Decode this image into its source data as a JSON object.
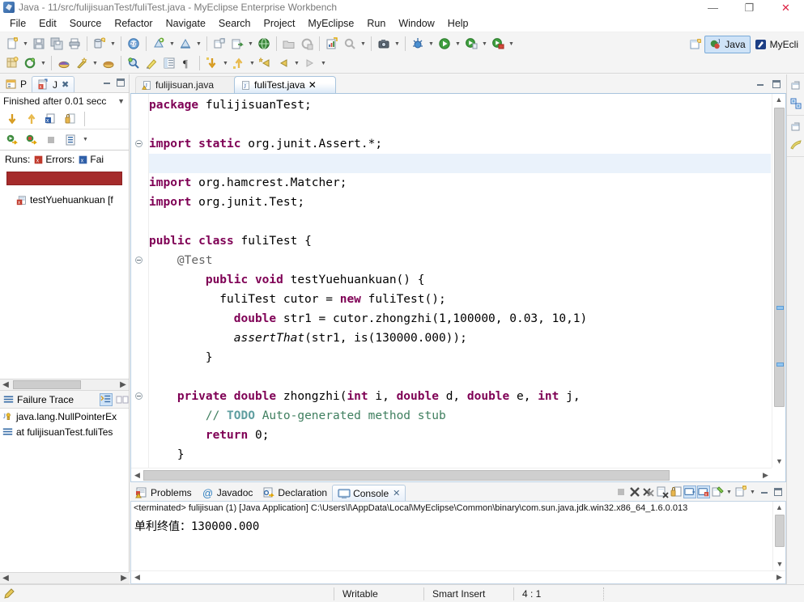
{
  "window": {
    "title": "Java - 11/src/fulijisuanTest/fuliTest.java - MyEclipse Enterprise Workbench",
    "minimize": "—",
    "maximize": "❐",
    "close": "✕"
  },
  "menubar": {
    "items": [
      {
        "label": "File"
      },
      {
        "label": "Edit"
      },
      {
        "label": "Source"
      },
      {
        "label": "Refactor"
      },
      {
        "label": "Navigate"
      },
      {
        "label": "Search"
      },
      {
        "label": "Project"
      },
      {
        "label": "MyEclipse"
      },
      {
        "label": "Run"
      },
      {
        "label": "Window"
      },
      {
        "label": "Help"
      }
    ]
  },
  "toolbar": {
    "row1": [
      {
        "name": "new-icon",
        "kind": "new"
      },
      {
        "name": "dropdown-arrow-icon",
        "kind": "arrow"
      },
      {
        "name": "save-icon",
        "kind": "save"
      },
      {
        "name": "save-all-icon",
        "kind": "saveall"
      },
      {
        "name": "print-icon",
        "kind": "print"
      },
      {
        "name": "separator",
        "kind": "sep"
      },
      {
        "name": "deploy-icon",
        "kind": "deploy"
      },
      {
        "name": "dropdown-arrow-icon",
        "kind": "arrow"
      },
      {
        "name": "separator",
        "kind": "sep"
      },
      {
        "name": "server-icon",
        "kind": "server"
      },
      {
        "name": "separator",
        "kind": "sep"
      },
      {
        "name": "db-browser-icon",
        "kind": "dbnew"
      },
      {
        "name": "dropdown-arrow-icon",
        "kind": "arrow"
      },
      {
        "name": "db-connect-icon",
        "kind": "dbconn"
      },
      {
        "name": "dropdown-arrow-icon",
        "kind": "arrow"
      },
      {
        "name": "separator",
        "kind": "sep"
      },
      {
        "name": "open-type-icon",
        "kind": "opentype"
      },
      {
        "name": "export-icon",
        "kind": "export"
      },
      {
        "name": "dropdown-arrow-icon",
        "kind": "arrow"
      },
      {
        "name": "web-browser-icon",
        "kind": "web"
      },
      {
        "name": "separator",
        "kind": "sep"
      },
      {
        "name": "open-folder-icon",
        "kind": "openfolder"
      },
      {
        "name": "refresh-icon",
        "kind": "refresh2"
      },
      {
        "name": "separator",
        "kind": "sep"
      },
      {
        "name": "report-icon",
        "kind": "report"
      },
      {
        "name": "search-icon",
        "kind": "searchgray"
      },
      {
        "name": "dropdown-arrow-icon",
        "kind": "arrow"
      },
      {
        "name": "separator",
        "kind": "sep"
      },
      {
        "name": "snapshot-icon",
        "kind": "camera"
      },
      {
        "name": "dropdown-arrow-icon",
        "kind": "arrow"
      },
      {
        "name": "separator",
        "kind": "sep"
      },
      {
        "name": "debug-icon",
        "kind": "debug"
      },
      {
        "name": "dropdown-arrow-icon",
        "kind": "arrow"
      },
      {
        "name": "run-icon",
        "kind": "run"
      },
      {
        "name": "dropdown-arrow-icon",
        "kind": "arrow"
      },
      {
        "name": "run-external-icon",
        "kind": "runext"
      },
      {
        "name": "dropdown-arrow-icon",
        "kind": "arrow"
      },
      {
        "name": "profile-icon",
        "kind": "profile"
      },
      {
        "name": "dropdown-arrow-icon",
        "kind": "arrow"
      }
    ],
    "row2": [
      {
        "name": "new-java-project-icon",
        "kind": "newjava"
      },
      {
        "name": "refresh-icon",
        "kind": "refresh"
      },
      {
        "name": "dropdown-arrow-icon",
        "kind": "arrow"
      },
      {
        "name": "separator",
        "kind": "sep"
      },
      {
        "name": "package-icon",
        "kind": "pkg"
      },
      {
        "name": "tool-icon",
        "kind": "wand"
      },
      {
        "name": "dropdown-arrow-icon",
        "kind": "arrow"
      },
      {
        "name": "package2-icon",
        "kind": "pkg2"
      },
      {
        "name": "separator",
        "kind": "sep"
      },
      {
        "name": "search-ref-icon",
        "kind": "searchref"
      },
      {
        "name": "highlight-icon",
        "kind": "highlight"
      },
      {
        "name": "outline-icon",
        "kind": "outline"
      },
      {
        "name": "pilcrow-icon",
        "kind": "pilcrow"
      },
      {
        "name": "separator",
        "kind": "sep"
      },
      {
        "name": "next-annotation-icon",
        "kind": "nextann"
      },
      {
        "name": "dropdown-arrow-icon",
        "kind": "arrow"
      },
      {
        "name": "prev-annotation-icon",
        "kind": "prevann"
      },
      {
        "name": "dropdown-arrow-icon",
        "kind": "arrow"
      },
      {
        "name": "back-star-icon",
        "kind": "backstar"
      },
      {
        "name": "back-icon",
        "kind": "back"
      },
      {
        "name": "dropdown-arrow-icon",
        "kind": "arrow"
      },
      {
        "name": "forward-icon",
        "kind": "forward"
      },
      {
        "name": "dropdown-arrow-icon",
        "kind": "arrow"
      }
    ],
    "perspectives": {
      "open_label": "",
      "items": [
        {
          "label": "Java",
          "active": true
        },
        {
          "label": "MyEcli",
          "active": false
        }
      ]
    }
  },
  "junit": {
    "tabs": [
      {
        "label": "P",
        "icon": "package-explorer-icon",
        "active": false
      },
      {
        "label": "J",
        "icon": "junit-icon",
        "active": true
      }
    ],
    "status": "Finished after 0.01 secc",
    "counts": {
      "runs_label": "Runs:",
      "runs_value": "",
      "errors_label": "Errors:",
      "errors_value": "",
      "failures_label": "Fai"
    },
    "progress_color": "#a52b2b",
    "tree": [
      {
        "label": "testYuehuankuan [f",
        "icon": "test-failed-icon"
      }
    ],
    "toolbar_row1": [
      {
        "name": "next-failure-icon"
      },
      {
        "name": "previous-failure-icon"
      },
      {
        "name": "show-failures-only-icon"
      },
      {
        "name": "lock-icon"
      }
    ],
    "toolbar_row2": [
      {
        "name": "rerun-test-icon"
      },
      {
        "name": "rerun-failed-tests-icon"
      },
      {
        "name": "stop-icon"
      },
      {
        "name": "test-history-icon"
      },
      {
        "name": "view-menu-icon"
      }
    ]
  },
  "failure_trace": {
    "title": "Failure Trace",
    "rows": [
      {
        "label": "java.lang.NullPointerEx",
        "icon": "exception-icon"
      },
      {
        "label": "at fulijisuanTest.fuliTes",
        "icon": "stackframe-icon"
      }
    ],
    "actions": [
      {
        "name": "filter-stacktrace-icon"
      },
      {
        "name": "compare-result-icon"
      }
    ]
  },
  "editor": {
    "tabs": [
      {
        "label": "fulijisuan.java",
        "active": false,
        "dirty": true,
        "icon": "java-file-warning-icon"
      },
      {
        "label": "fuliTest.java",
        "active": true,
        "dirty": false,
        "icon": "java-file-icon",
        "close": "✕"
      }
    ],
    "code_lines": [
      {
        "indent": 0,
        "fold": false,
        "highlight": false,
        "tokens": [
          {
            "t": "package",
            "c": "kw"
          },
          {
            "t": " fulijisuanTest;",
            "c": "plain"
          }
        ]
      },
      {
        "indent": 0,
        "fold": false,
        "highlight": false,
        "tokens": []
      },
      {
        "indent": 0,
        "fold": true,
        "highlight": false,
        "tokens": [
          {
            "t": "import static",
            "c": "kw"
          },
          {
            "t": " org.junit.Assert.*;",
            "c": "plain"
          }
        ]
      },
      {
        "indent": 0,
        "fold": false,
        "highlight": true,
        "tokens": []
      },
      {
        "indent": 0,
        "fold": false,
        "highlight": false,
        "tokens": [
          {
            "t": "import",
            "c": "kw"
          },
          {
            "t": " org.hamcrest.Matcher;",
            "c": "plain"
          }
        ]
      },
      {
        "indent": 0,
        "fold": false,
        "highlight": false,
        "tokens": [
          {
            "t": "import",
            "c": "kw"
          },
          {
            "t": " org.junit.Test;",
            "c": "plain"
          }
        ]
      },
      {
        "indent": 0,
        "fold": false,
        "highlight": false,
        "tokens": []
      },
      {
        "indent": 0,
        "fold": false,
        "highlight": false,
        "tokens": [
          {
            "t": "public class",
            "c": "kw"
          },
          {
            "t": " fuliTest {",
            "c": "plain"
          }
        ]
      },
      {
        "indent": 1,
        "fold": true,
        "highlight": false,
        "tokens": [
          {
            "t": "@Test",
            "c": "ann"
          }
        ]
      },
      {
        "indent": 2,
        "fold": false,
        "highlight": false,
        "tokens": [
          {
            "t": "public void",
            "c": "kw"
          },
          {
            "t": " testYuehuankuan() {",
            "c": "plain"
          }
        ]
      },
      {
        "indent": 2,
        "fold": false,
        "highlight": false,
        "tokens": [
          {
            "t": "  fuliTest cutor = ",
            "c": "plain"
          },
          {
            "t": "new",
            "c": "kw"
          },
          {
            "t": " fuliTest();",
            "c": "plain"
          }
        ]
      },
      {
        "indent": 3,
        "fold": false,
        "highlight": false,
        "tokens": [
          {
            "t": "double",
            "c": "kw"
          },
          {
            "t": " str1 = cutor.zhongzhi(1,100000, 0.03, 10,1)",
            "c": "plain"
          }
        ]
      },
      {
        "indent": 3,
        "fold": false,
        "highlight": false,
        "tokens": [
          {
            "t": "assertThat",
            "c": "ital"
          },
          {
            "t": "(str1, is(130000.000));",
            "c": "plain"
          }
        ]
      },
      {
        "indent": 2,
        "fold": false,
        "highlight": false,
        "tokens": [
          {
            "t": "}",
            "c": "plain"
          }
        ]
      },
      {
        "indent": 0,
        "fold": false,
        "highlight": false,
        "tokens": []
      },
      {
        "indent": 1,
        "fold": true,
        "highlight": false,
        "tokens": [
          {
            "t": "private double",
            "c": "kw"
          },
          {
            "t": " zhongzhi(",
            "c": "plain"
          },
          {
            "t": "int",
            "c": "kw"
          },
          {
            "t": " i, ",
            "c": "plain"
          },
          {
            "t": "double",
            "c": "kw"
          },
          {
            "t": " d, ",
            "c": "plain"
          },
          {
            "t": "double",
            "c": "kw"
          },
          {
            "t": " e, ",
            "c": "plain"
          },
          {
            "t": "int",
            "c": "kw"
          },
          {
            "t": " j, ",
            "c": "plain"
          }
        ]
      },
      {
        "indent": 2,
        "fold": false,
        "highlight": false,
        "tokens": [
          {
            "t": "// ",
            "c": "cmt"
          },
          {
            "t": "TODO",
            "c": "todo"
          },
          {
            "t": " Auto-generated method stub",
            "c": "cmt"
          }
        ]
      },
      {
        "indent": 2,
        "fold": false,
        "highlight": false,
        "tokens": [
          {
            "t": "return",
            "c": "kw"
          },
          {
            "t": " 0;",
            "c": "plain"
          }
        ]
      },
      {
        "indent": 1,
        "fold": false,
        "highlight": false,
        "tokens": [
          {
            "t": "}",
            "c": "plain"
          }
        ]
      }
    ]
  },
  "console": {
    "tabs": [
      {
        "label": "Problems",
        "icon": "problems-icon",
        "active": false
      },
      {
        "label": "Javadoc",
        "icon": "javadoc-icon",
        "active": false
      },
      {
        "label": "Declaration",
        "icon": "declaration-icon",
        "active": false
      },
      {
        "label": "Console",
        "icon": "console-icon",
        "active": true,
        "close": "✕"
      }
    ],
    "launch_line": "<terminated> fulijisuan (1) [Java Application] C:\\Users\\l\\AppData\\Local\\MyEclipse\\Common\\binary\\com.sun.java.jdk.win32.x86_64_1.6.0.013",
    "output": "单利终值：130000.000",
    "actions": [
      {
        "name": "terminate-icon"
      },
      {
        "name": "remove-launch-icon"
      },
      {
        "name": "remove-all-launches-icon"
      },
      {
        "name": "clear-console-icon"
      },
      {
        "name": "lock-scroll-icon"
      },
      {
        "name": "scroll-lock-icon"
      },
      {
        "name": "pin-console-icon"
      },
      {
        "name": "display-console-icon"
      },
      {
        "name": "display-console-dropdown-icon"
      },
      {
        "name": "open-console-icon"
      },
      {
        "name": "open-console-dropdown-icon"
      },
      {
        "name": "minimize-icon"
      },
      {
        "name": "maximize-icon"
      }
    ]
  },
  "rightbar": {
    "groups": [
      [
        {
          "name": "restore-icon"
        },
        {
          "name": "package-explorer-icon"
        }
      ],
      [
        {
          "name": "restore-icon"
        },
        {
          "name": "outline-icon"
        }
      ]
    ]
  },
  "statusbar": {
    "left_icon": "writable-state-icon",
    "cells": [
      {
        "label": "Writable"
      },
      {
        "label": "Smart Insert"
      },
      {
        "label": "4 : 1"
      }
    ]
  }
}
